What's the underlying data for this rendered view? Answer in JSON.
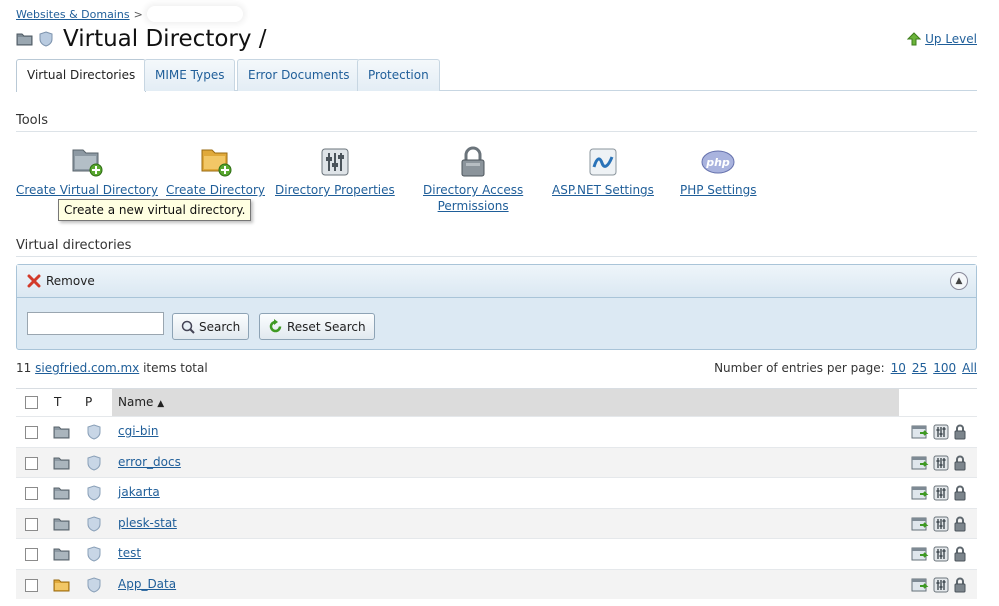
{
  "breadcrumb": {
    "root": "Websites & Domains",
    "separator": ">"
  },
  "title": "Virtual Directory /",
  "up_level": "Up Level",
  "tabs": [
    {
      "label": "Virtual Directories",
      "active": true
    },
    {
      "label": "MIME Types",
      "active": false
    },
    {
      "label": "Error Documents",
      "active": false
    },
    {
      "label": "Protection",
      "active": false
    }
  ],
  "tools": {
    "header": "Tools",
    "create_virtual_directory": "Create Virtual Directory",
    "create_directory": "Create Directory",
    "directory_properties": "Directory Properties",
    "directory_access_line1": "Directory Access",
    "directory_access_line2": "Permissions",
    "aspnet_settings": "ASP.NET Settings",
    "php_settings": "PHP Settings",
    "php_icon_text": "php",
    "tooltip": "Create a new virtual directory."
  },
  "list": {
    "header": "Virtual directories",
    "remove": "Remove",
    "search_value": "",
    "search_button": "Search",
    "reset_button": "Reset Search",
    "count": "11",
    "domain": "siegfried.com.mx",
    "items_total": "items total",
    "per_page_label": "Number of entries per page:",
    "per_page_options": [
      "10",
      "25",
      "100",
      "All"
    ],
    "columns": {
      "type": "T",
      "protection": "P",
      "name": "Name",
      "sort_indicator": "▲"
    },
    "rows": [
      {
        "name": "cgi-bin",
        "folder": "grey"
      },
      {
        "name": "error_docs",
        "folder": "grey"
      },
      {
        "name": "jakarta",
        "folder": "grey"
      },
      {
        "name": "plesk-stat",
        "folder": "grey"
      },
      {
        "name": "test",
        "folder": "grey"
      },
      {
        "name": "App_Data",
        "folder": "yellow"
      }
    ]
  },
  "colors": {
    "link": "#1f5e99",
    "panel": "#dce9f3",
    "tooltip_bg": "#ffffe1"
  }
}
